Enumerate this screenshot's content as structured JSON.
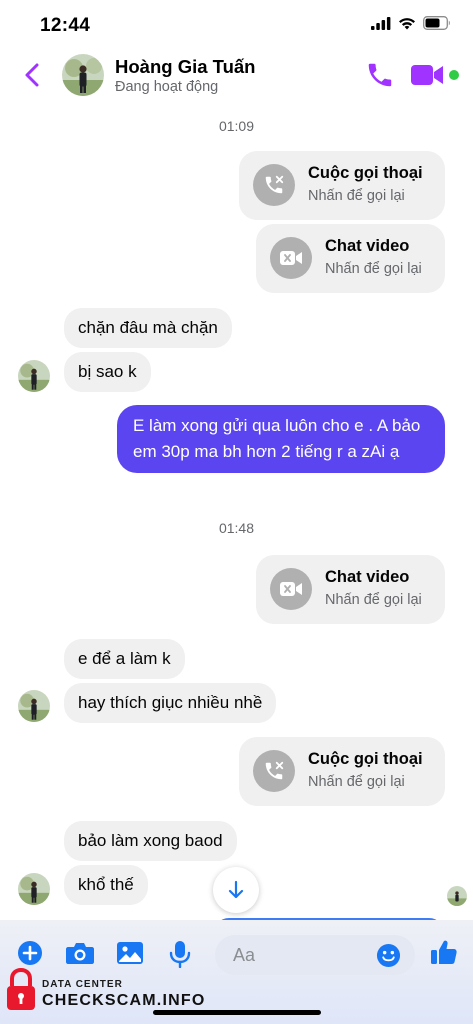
{
  "status_bar": {
    "time": "12:44"
  },
  "header": {
    "contact_name": "Hoàng Gia Tuấn",
    "contact_status": "Đang hoạt động",
    "accent_color": "#a033ff",
    "online_color": "#31cc46"
  },
  "messages": {
    "time_1": "01:09",
    "call_1": {
      "title": "Cuộc gọi thoại",
      "subtitle": "Nhấn để gọi lại",
      "icon": "missed-call-icon"
    },
    "video_1": {
      "title": "Chat video",
      "subtitle": "Nhấn để gọi lại",
      "icon": "missed-video-icon"
    },
    "in_1": "chặn đâu mà chặn",
    "in_2": "bị sao k",
    "out_1": "E làm xong gửi qua luôn cho e . A bảo em 30p ma bh hơn 2 tiếng r a zAi ạ",
    "time_2": "01:48",
    "video_2": {
      "title": "Chat video",
      "subtitle": "Nhấn để gọi lại",
      "icon": "missed-video-icon"
    },
    "in_3": "e để a làm k",
    "in_4": "hay thích giục nhiều nhề",
    "call_2": {
      "title": "Cuộc gọi thoại",
      "subtitle": "Nhấn để gọi lại",
      "icon": "missed-call-icon"
    },
    "in_5": "bảo làm xong baod",
    "in_6": "khổ thế",
    "outgoing_bubble_color": "#5b45f1",
    "incoming_bubble_color": "#f0f0f0"
  },
  "composer": {
    "placeholder": "Aa",
    "accent_color": "#1877f2"
  },
  "watermark": {
    "small": "DATA CENTER",
    "big": "CHECKSCAM.INFO",
    "lock_color": "#e8192c"
  }
}
